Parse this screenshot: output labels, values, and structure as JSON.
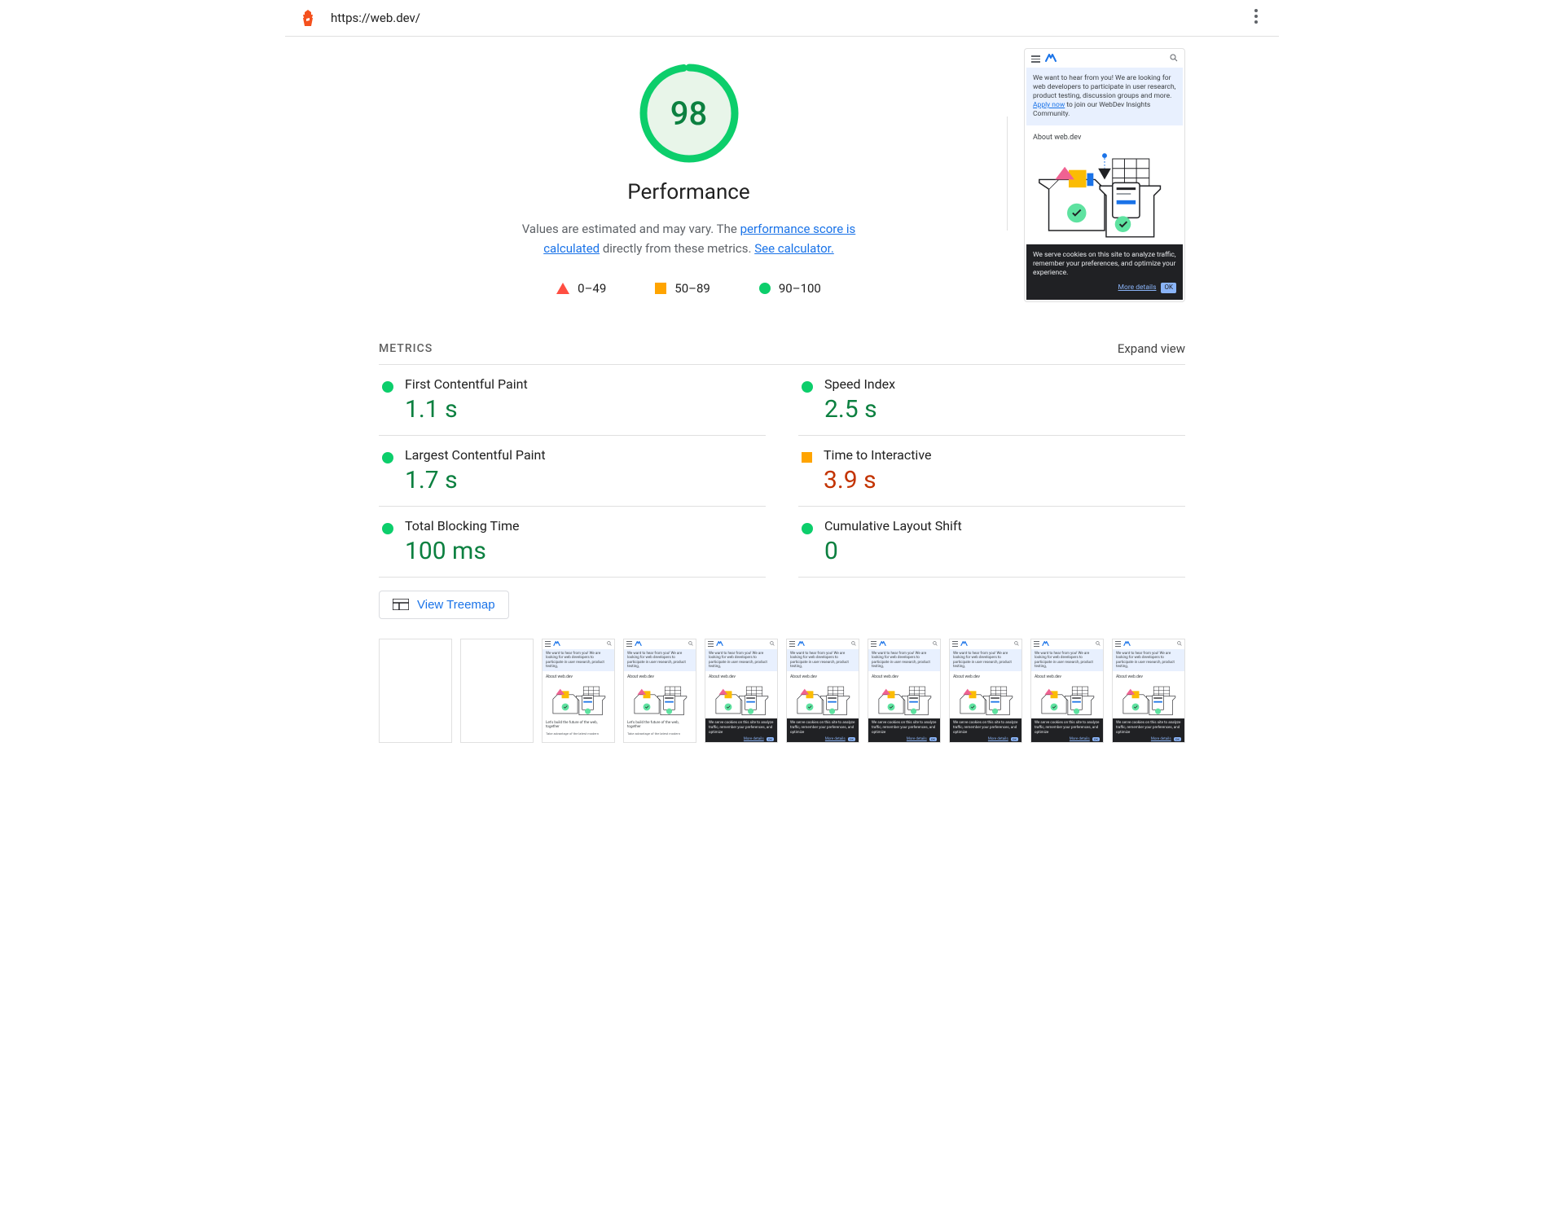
{
  "header": {
    "url": "https://web.dev/"
  },
  "gauge": {
    "score": "98",
    "title": "Performance",
    "desc_prefix": "Values are estimated and may vary. The ",
    "link1": "performance score is calculated",
    "desc_mid": " directly from these metrics. ",
    "link2": "See calculator."
  },
  "legend": {
    "fail": "0–49",
    "avg": "50–89",
    "pass": "90–100"
  },
  "metrics_header": {
    "label": "METRICS",
    "expand": "Expand view"
  },
  "metrics": [
    {
      "name": "First Contentful Paint",
      "value": "1.1 s",
      "status": "pass"
    },
    {
      "name": "Speed Index",
      "value": "2.5 s",
      "status": "pass"
    },
    {
      "name": "Largest Contentful Paint",
      "value": "1.7 s",
      "status": "pass"
    },
    {
      "name": "Time to Interactive",
      "value": "3.9 s",
      "status": "avg"
    },
    {
      "name": "Total Blocking Time",
      "value": "100 ms",
      "status": "pass"
    },
    {
      "name": "Cumulative Layout Shift",
      "value": "0",
      "status": "pass"
    }
  ],
  "treemap_button": "View Treemap",
  "preview": {
    "banner_text": "We want to hear from you! We are looking for web developers to participate in user research, product testing, discussion groups and more. ",
    "banner_link": "Apply now",
    "banner_suffix": " to join our WebDev Insights Community.",
    "about": "About web.dev",
    "cookie_text": "We serve cookies on this site to analyze traffic, remember your preferences, and optimize your experience.",
    "more_details": "More details",
    "ok": "OK"
  },
  "filmstrip": {
    "frames": [
      {
        "state": "blank"
      },
      {
        "state": "blank"
      },
      {
        "state": "partial"
      },
      {
        "state": "partial"
      },
      {
        "state": "cookie"
      },
      {
        "state": "cookie"
      },
      {
        "state": "cookie"
      },
      {
        "state": "cookie"
      },
      {
        "state": "cookie"
      },
      {
        "state": "cookie"
      }
    ],
    "partial_footer": "Let's build the future of the web, together",
    "partial_sub": "Take advantage of the latest modern"
  },
  "colors": {
    "pass": "#0cce6b",
    "avg": "#ffa400",
    "fail": "#ff4e42"
  }
}
